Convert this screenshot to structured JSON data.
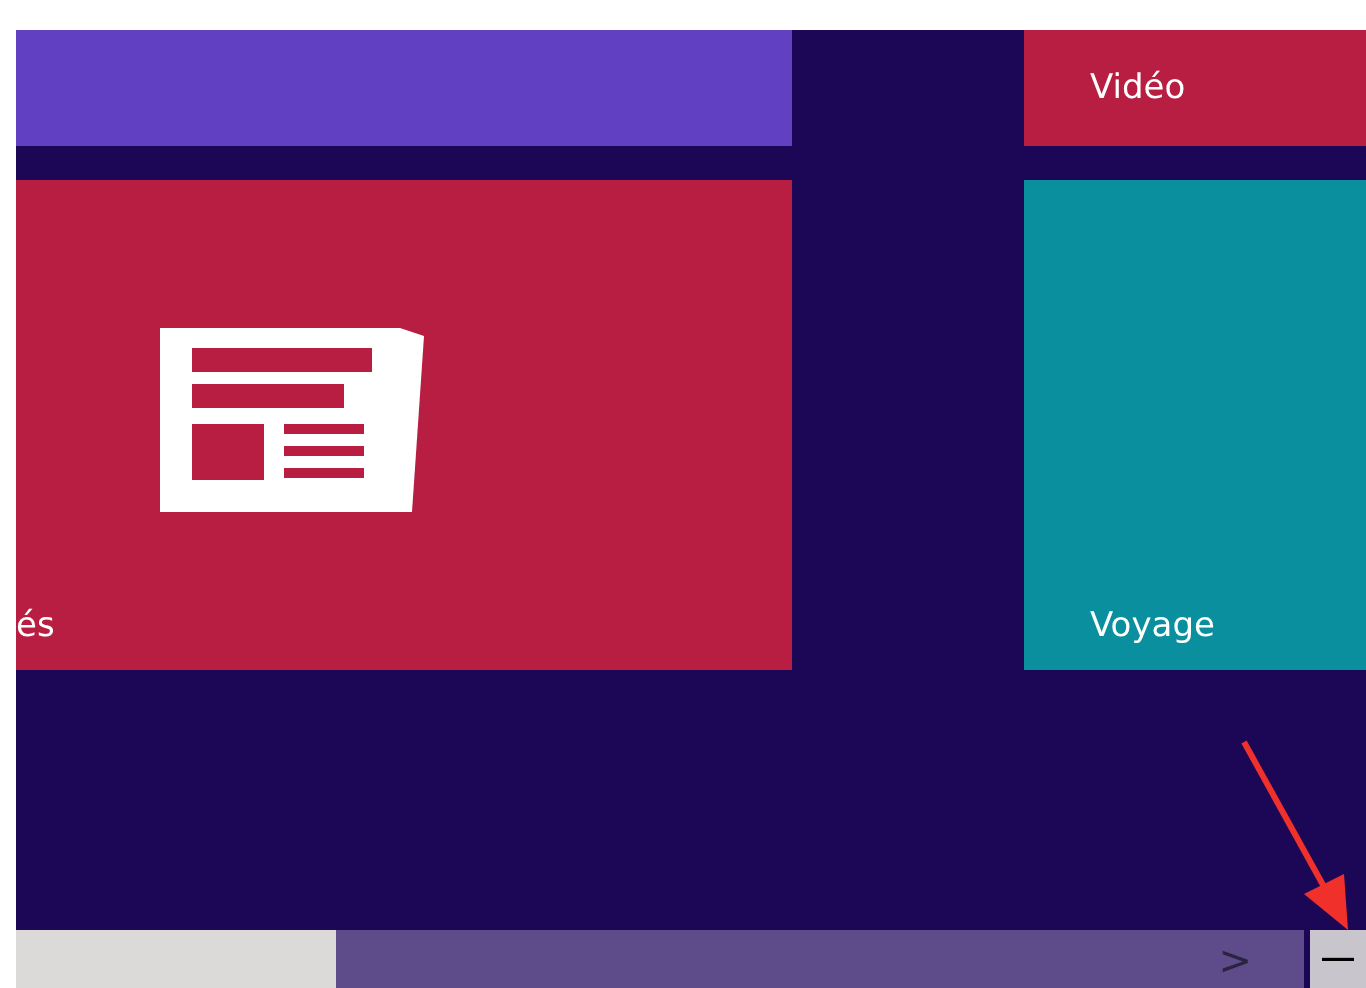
{
  "tiles": [
    {
      "kind": "plain",
      "color": "#6140c2"
    },
    {
      "kind": "label",
      "label": "Vidéo",
      "color": "#b81e42"
    },
    {
      "kind": "news",
      "label": "és",
      "color": "#b81e42"
    },
    {
      "kind": "label",
      "label": "Voyage",
      "color": "#0a8f9e"
    }
  ],
  "scrollbar": {
    "arrow": ">"
  },
  "zoom_button": {
    "label": "—"
  }
}
